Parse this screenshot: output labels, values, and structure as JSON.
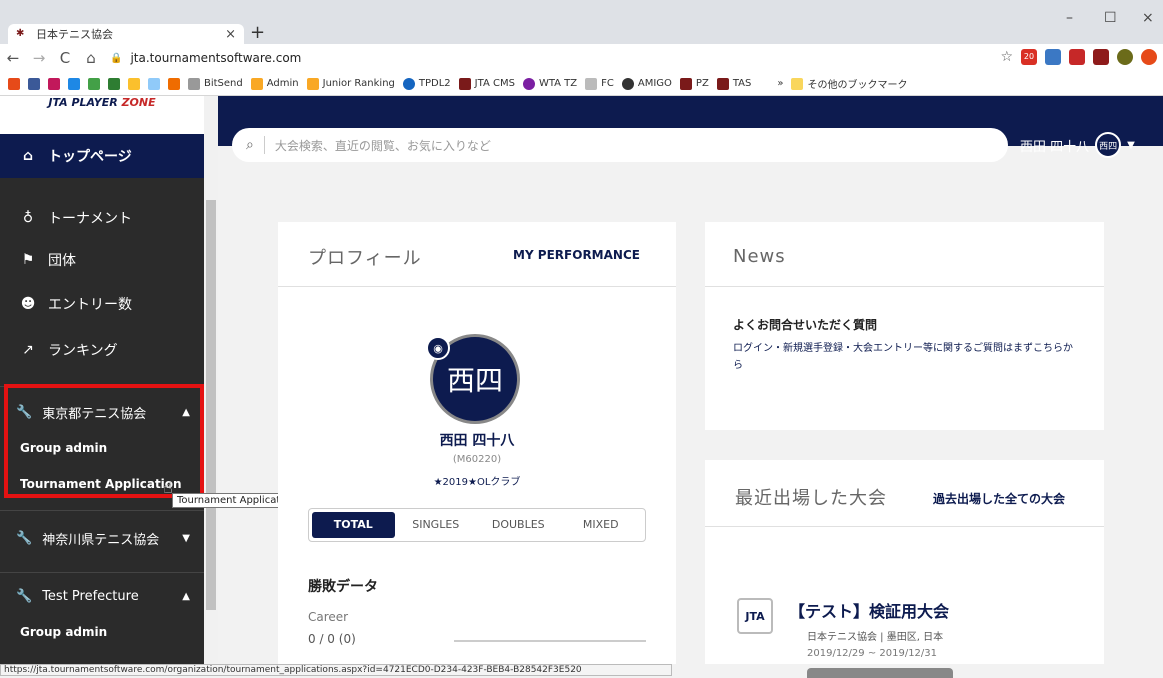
{
  "browser": {
    "tab_title": "日本テニス協会",
    "tab_close": "×",
    "new_tab": "+",
    "url": "jta.tournamentsoftware.com",
    "nav_back": "←",
    "nav_forward": "→",
    "nav_reload": "C",
    "nav_home": "⌂",
    "win_min": "–",
    "win_max": "☐",
    "win_close": "×",
    "bookmarks": [
      "BitSend",
      "Admin",
      "Junior Ranking",
      "TPDL2",
      "JTA CMS",
      "WTA TZ",
      "FC",
      "AMIGO",
      "PZ",
      "TAS"
    ],
    "bookmarks_more": "»",
    "other_bookmarks": "その他のブックマーク",
    "ext_badge": "20",
    "status_url": "https://jta.tournamentsoftware.com/organization/tournament_applications.aspx?id=4721ECD0-D234-423F-BEB4-B28542F3E520"
  },
  "sidebar": {
    "logo_text": "JTA PLAYER",
    "logo_zone": "ZONE",
    "items": [
      {
        "label": "トップページ",
        "icon": "home-icon"
      },
      {
        "label": "トーナメント",
        "icon": "medal-icon"
      },
      {
        "label": "団体",
        "icon": "flag-icon"
      },
      {
        "label": "エントリー数",
        "icon": "users-icon"
      },
      {
        "label": "ランキング",
        "icon": "chart-icon"
      }
    ],
    "groups": [
      {
        "label": "東京都テニス協会",
        "expanded": true,
        "subs": [
          "Group admin",
          "Tournament Application"
        ]
      },
      {
        "label": "神奈川県テニス協会",
        "expanded": false,
        "subs": []
      },
      {
        "label": "Test Prefecture",
        "expanded": true,
        "subs": [
          "Group admin"
        ]
      }
    ],
    "tooltip": "Tournament Application"
  },
  "header": {
    "search_placeholder": "大会検索、直近の閲覧、お気に入りなど",
    "user_name": "西田 四十八",
    "avatar_initials": "西四"
  },
  "profile": {
    "title": "プロフィール",
    "performance_link": "MY PERFORMANCE",
    "avatar_initials": "西四",
    "name": "西田 四十八",
    "member_id": "(M60220)",
    "club": "★2019★OLクラブ",
    "tabs": [
      "TOTAL",
      "SINGLES",
      "DOUBLES",
      "MIXED"
    ],
    "active_tab": "TOTAL",
    "stats_title": "勝敗データ",
    "career_label": "Career",
    "career_value": "0 / 0 (0)"
  },
  "news": {
    "title": "News",
    "question": "よくお問合せいただく質問",
    "description": "ログイン・新規選手登録・大会エントリー等に関するご質問はまずこちらから"
  },
  "recent": {
    "title": "最近出場した大会",
    "all_link": "過去出場した全ての大会",
    "tournament_name": "【テスト】検証用大会",
    "tournament_logo": "JTA",
    "location": "日本テニス協会 | 墨田区, 日本",
    "dates": "2019/12/29 ~ 2019/12/31"
  },
  "colors": {
    "navy": "#0d1b4f",
    "highlight": "#e41212"
  }
}
